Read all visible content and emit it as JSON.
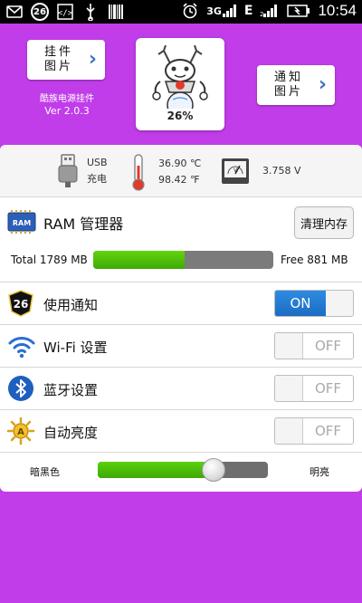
{
  "status_bar": {
    "badge": "26",
    "network": "3G",
    "edge": "E",
    "time": "10:54"
  },
  "header": {
    "plugin_button": {
      "line1": "挂件",
      "line2": "图片"
    },
    "plugin_name": "酷族电源挂件",
    "version": "Ver 2.0.3",
    "battery_percent": "26%",
    "notify_button": {
      "line1": "通知",
      "line2": "图片"
    }
  },
  "info": {
    "usb": {
      "line1": "USB",
      "line2": "充电"
    },
    "temperature": {
      "celsius": "36.90 ℃",
      "fahrenheit": "98.42 ℉"
    },
    "voltage": "3.758 V"
  },
  "ram": {
    "icon_text": "RAM",
    "title": "RAM 管理器",
    "clean_button": "清理内存",
    "total": "Total 1789 MB",
    "free": "Free 881 MB",
    "used_fraction": 0.51
  },
  "toggles": [
    {
      "label": "使用通知",
      "state": "ON",
      "on": true,
      "icon": "notification-26-icon",
      "badge": "26"
    },
    {
      "label": "Wi-Fi 设置",
      "state": "OFF",
      "on": false,
      "icon": "wifi-icon"
    },
    {
      "label": "蓝牙设置",
      "state": "OFF",
      "on": false,
      "icon": "bluetooth-icon"
    },
    {
      "label": "自动亮度",
      "state": "OFF",
      "on": false,
      "icon": "brightness-icon"
    }
  ],
  "brightness": {
    "dark_label": "暗黑色",
    "bright_label": "明亮",
    "level": 0.68
  },
  "colors": {
    "background": "#c13de9",
    "accent_blue": "#1c6cc4",
    "progress_green": "#4cbc08"
  }
}
